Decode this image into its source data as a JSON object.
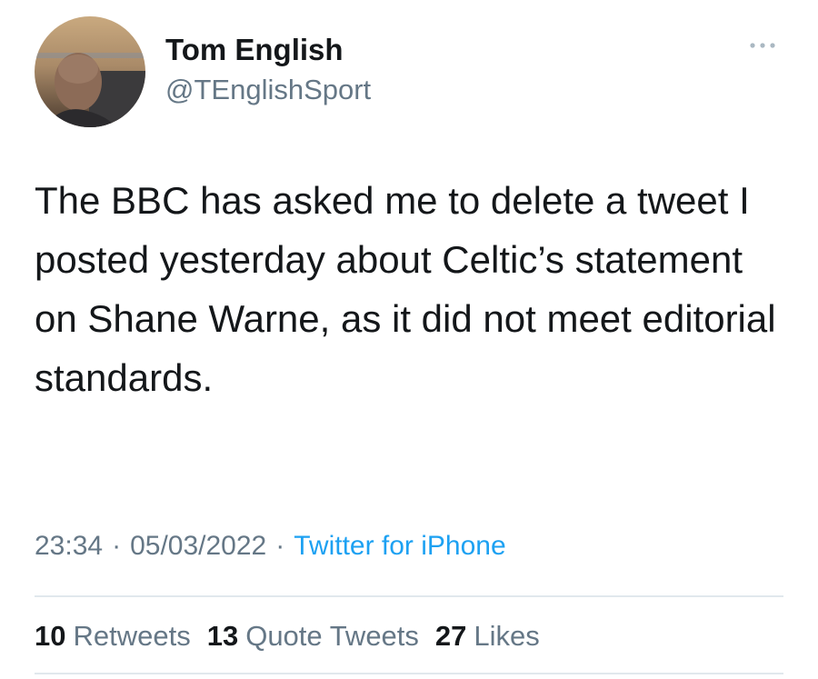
{
  "tweet": {
    "author": {
      "display_name": "Tom English",
      "handle": "@TEnglishSport"
    },
    "more_icon": "more-options-icon",
    "text": "The BBC has asked me to delete a tweet I posted yesterday about Celtic’s statement on Shane Warne, as it did not meet editorial standards.",
    "time": "23:34",
    "date": "05/03/2022",
    "source": "Twitter for iPhone",
    "separator": "·"
  },
  "stats": {
    "retweets": {
      "count": "10",
      "label": "Retweets"
    },
    "quote_tweets": {
      "count": "13",
      "label": "Quote Tweets"
    },
    "likes": {
      "count": "27",
      "label": "Likes"
    }
  },
  "colors": {
    "text_primary": "#14171a",
    "text_secondary": "#657786",
    "link": "#1da1f2",
    "divider": "#e1e8ed"
  }
}
